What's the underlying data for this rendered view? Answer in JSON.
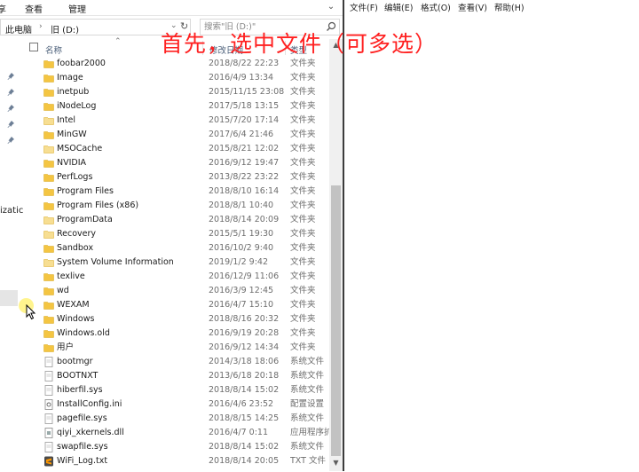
{
  "explorer": {
    "ribbon_tabs": [
      "享",
      "查看",
      "管理"
    ],
    "address": {
      "root": "此电脑",
      "separator": "›",
      "current": "旧 (D:)"
    },
    "search": {
      "placeholder": "搜索\"旧 (D:)\""
    },
    "nav_partial_text": "izatic",
    "columns": {
      "name": "名称",
      "date": "修改日期",
      "type": "类型"
    },
    "files": [
      {
        "name": "foobar2000",
        "date": "2018/8/22 22:23",
        "type": "文件夹",
        "icon": "folder"
      },
      {
        "name": "Image",
        "date": "2016/4/9 13:34",
        "type": "文件夹",
        "icon": "folder"
      },
      {
        "name": "inetpub",
        "date": "2015/11/15 23:08",
        "type": "文件夹",
        "icon": "folder"
      },
      {
        "name": "iNodeLog",
        "date": "2017/5/18 13:15",
        "type": "文件夹",
        "icon": "folder"
      },
      {
        "name": "Intel",
        "date": "2015/7/20 17:14",
        "type": "文件夹",
        "icon": "folder-light"
      },
      {
        "name": "MinGW",
        "date": "2017/6/4 21:46",
        "type": "文件夹",
        "icon": "folder"
      },
      {
        "name": "MSOCache",
        "date": "2015/8/21 12:02",
        "type": "文件夹",
        "icon": "folder-light"
      },
      {
        "name": "NVIDIA",
        "date": "2016/9/12 19:47",
        "type": "文件夹",
        "icon": "folder"
      },
      {
        "name": "PerfLogs",
        "date": "2013/8/22 23:22",
        "type": "文件夹",
        "icon": "folder"
      },
      {
        "name": "Program Files",
        "date": "2018/8/10 16:14",
        "type": "文件夹",
        "icon": "folder"
      },
      {
        "name": "Program Files (x86)",
        "date": "2018/8/1 10:40",
        "type": "文件夹",
        "icon": "folder"
      },
      {
        "name": "ProgramData",
        "date": "2018/8/14 20:09",
        "type": "文件夹",
        "icon": "folder-light"
      },
      {
        "name": "Recovery",
        "date": "2015/5/1 19:30",
        "type": "文件夹",
        "icon": "folder-light"
      },
      {
        "name": "Sandbox",
        "date": "2016/10/2 9:40",
        "type": "文件夹",
        "icon": "folder"
      },
      {
        "name": "System Volume Information",
        "date": "2019/1/2 9:42",
        "type": "文件夹",
        "icon": "folder-light"
      },
      {
        "name": "texlive",
        "date": "2016/12/9 11:06",
        "type": "文件夹",
        "icon": "folder"
      },
      {
        "name": "wd",
        "date": "2016/3/9 12:45",
        "type": "文件夹",
        "icon": "folder"
      },
      {
        "name": "WEXAM",
        "date": "2016/4/7 15:10",
        "type": "文件夹",
        "icon": "folder"
      },
      {
        "name": "Windows",
        "date": "2018/8/16 20:32",
        "type": "文件夹",
        "icon": "folder"
      },
      {
        "name": "Windows.old",
        "date": "2016/9/19 20:28",
        "type": "文件夹",
        "icon": "folder"
      },
      {
        "name": "用户",
        "date": "2016/9/12 14:34",
        "type": "文件夹",
        "icon": "folder"
      },
      {
        "name": "bootmgr",
        "date": "2014/3/18 18:06",
        "type": "系统文件",
        "icon": "system-file"
      },
      {
        "name": "BOOTNXT",
        "date": "2013/6/18 20:18",
        "type": "系统文件",
        "icon": "system-file"
      },
      {
        "name": "hiberfil.sys",
        "date": "2018/8/14 15:02",
        "type": "系统文件",
        "icon": "system-file"
      },
      {
        "name": "InstallConfig.ini",
        "date": "2016/4/6 23:52",
        "type": "配置设置",
        "icon": "config-file"
      },
      {
        "name": "pagefile.sys",
        "date": "2018/8/15 14:25",
        "type": "系统文件",
        "icon": "system-file"
      },
      {
        "name": "qiyi_xkernels.dll",
        "date": "2016/4/7 0:11",
        "type": "应用程序扩",
        "icon": "dll-file"
      },
      {
        "name": "swapfile.sys",
        "date": "2018/8/14 15:02",
        "type": "系统文件",
        "icon": "system-file"
      },
      {
        "name": "WiFi_Log.txt",
        "date": "2018/8/14 20:05",
        "type": "TXT 文件",
        "icon": "sublime-text-file"
      }
    ]
  },
  "notepad": {
    "menu": [
      "文件(F)",
      "编辑(E)",
      "格式(O)",
      "查看(V)",
      "帮助(H)"
    ]
  },
  "overlay": {
    "caption": "首先，选中文件（可多选）",
    "caption_color": "#ff2020"
  },
  "colors": {
    "folder": "#f4c542",
    "folder_light": "#f7de92",
    "header_text": "#4c607a",
    "secondary_text": "#6d6d6d"
  }
}
